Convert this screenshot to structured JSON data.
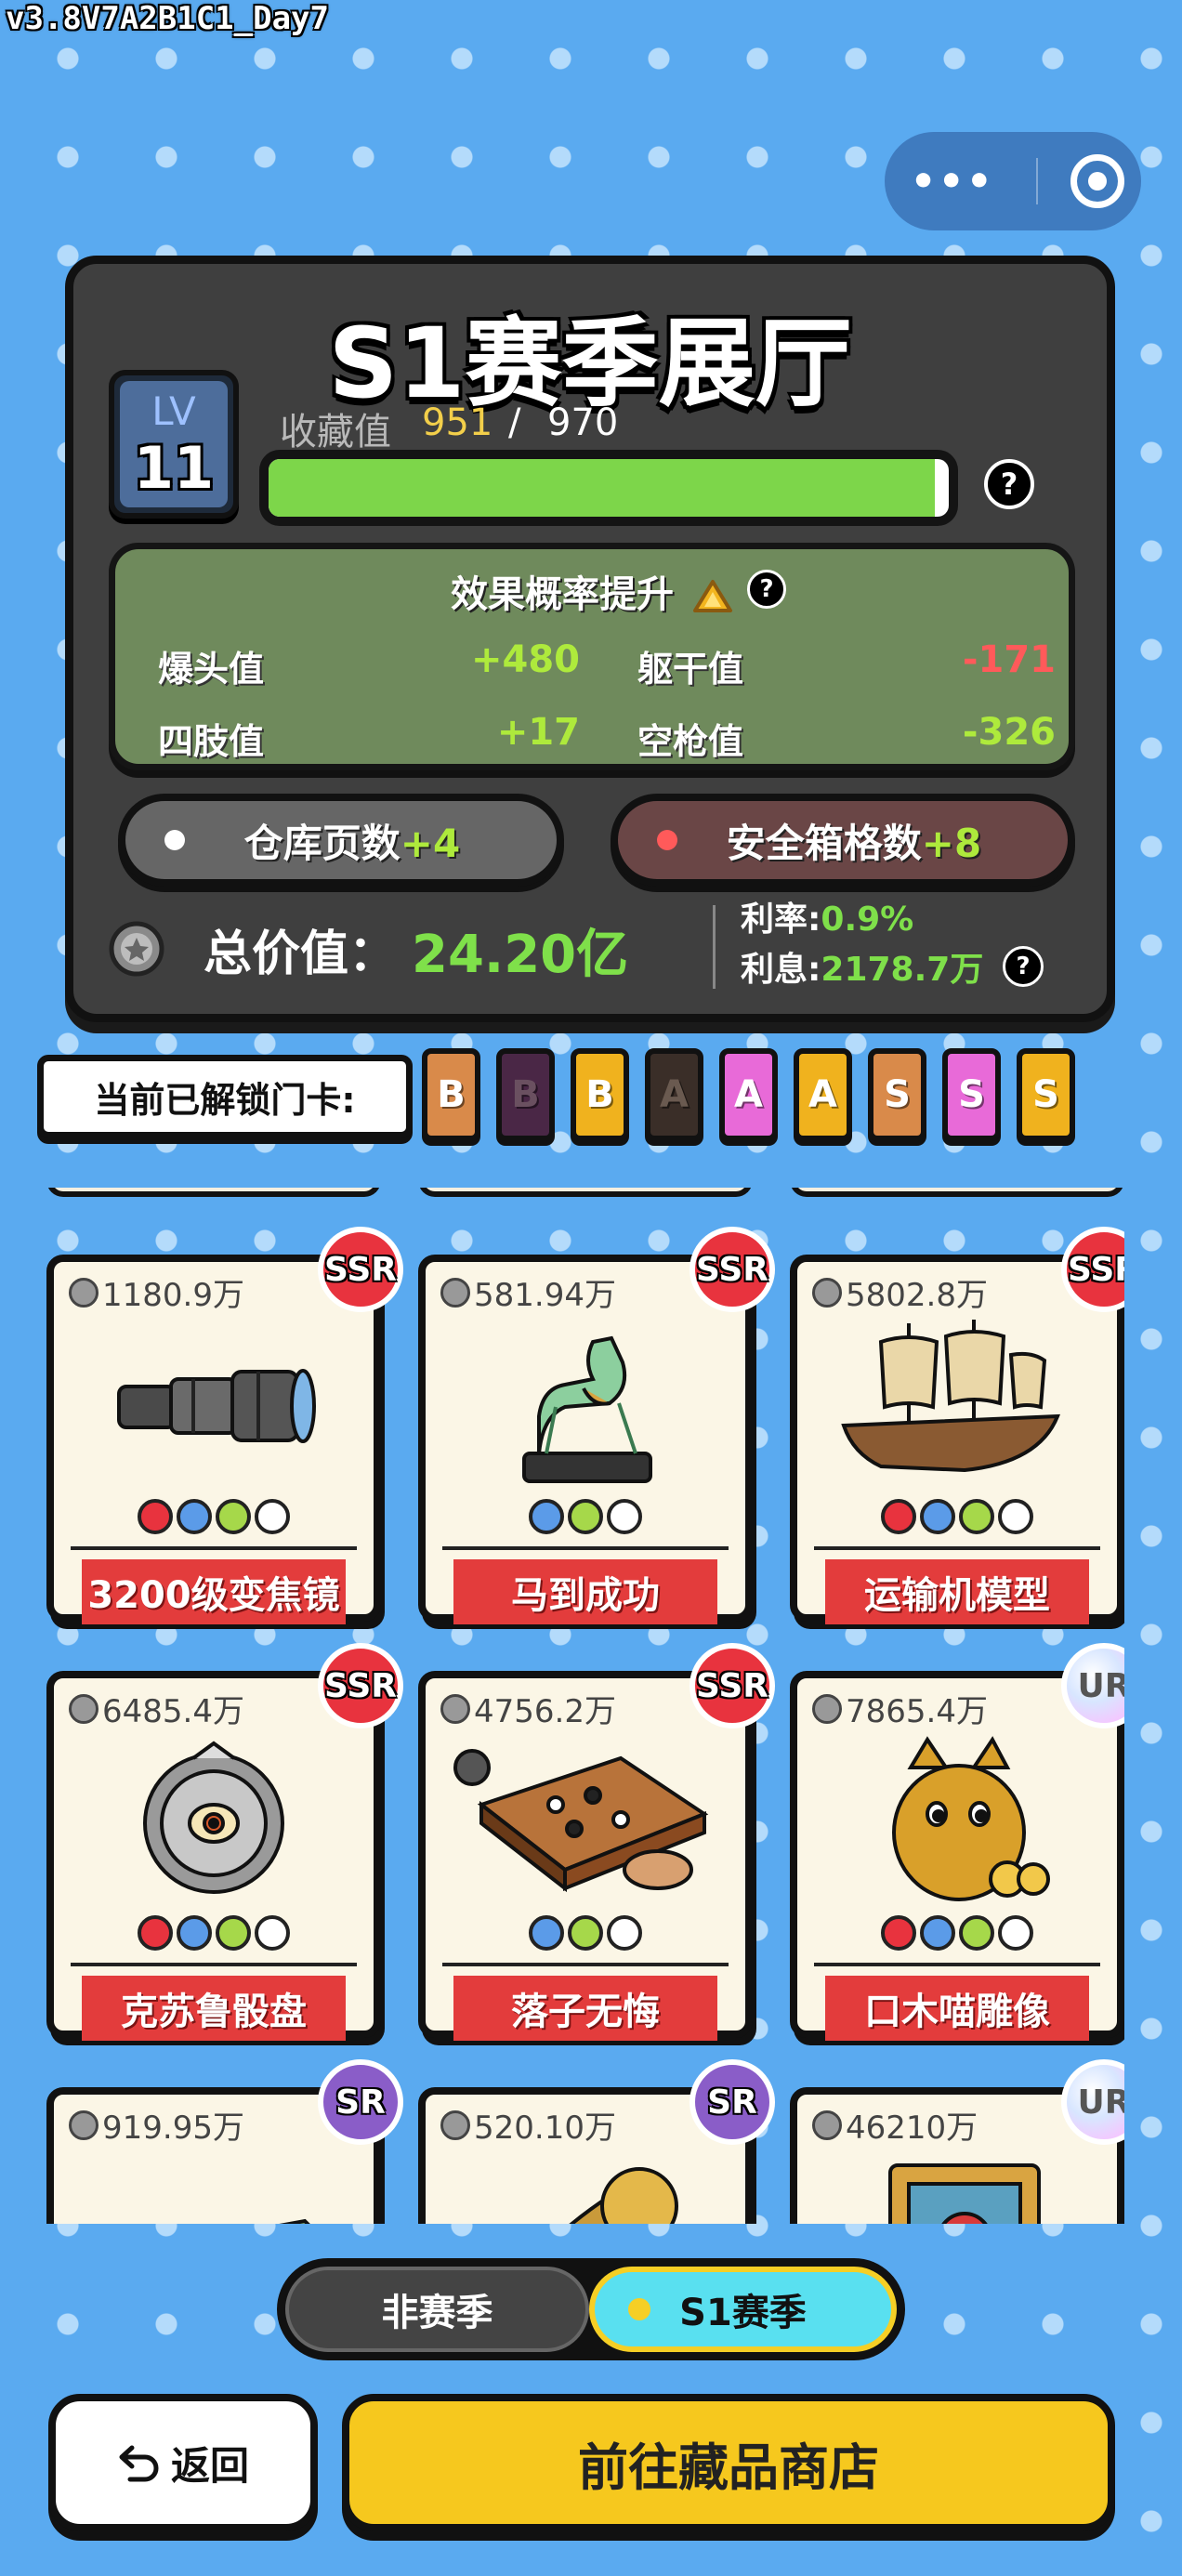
{
  "version": "v3.8V7A2B1C1_Day7",
  "capsule": {
    "more_icon": "more-dots-icon",
    "close_icon": "target-circle-icon"
  },
  "hall": {
    "title": "S1赛季展厅",
    "level_label": "LV",
    "level": "11",
    "collection_label": "收藏值",
    "collection_current": "951",
    "collection_separator": "/",
    "collection_max": "970",
    "progress_fraction": 0.98,
    "help": "?"
  },
  "effect": {
    "title": "效果概率提升",
    "help": "?",
    "stats": [
      {
        "label": "爆头值",
        "value": "+480",
        "positive": true
      },
      {
        "label": "躯干值",
        "value": "-171",
        "positive": false
      },
      {
        "label": "四肢值",
        "value": "+17",
        "positive": true
      },
      {
        "label": "空枪值",
        "value": "-326",
        "positive": false
      }
    ]
  },
  "buffs": {
    "warehouse": {
      "label": "仓库页数",
      "bonus": "+4"
    },
    "safebox": {
      "label": "安全箱格数",
      "bonus": "+8"
    }
  },
  "totals": {
    "total_label": "总价值：",
    "total_value": "24.20亿",
    "rate_label": "利率:",
    "rate_value": "0.9%",
    "interest_label": "利息:",
    "interest_value": "2178.7万",
    "help": "?"
  },
  "unlocked": {
    "label": "当前已解锁门卡:",
    "cards": [
      {
        "letter": "B",
        "color": "#d98a4a",
        "text_color": "#ffffff"
      },
      {
        "letter": "B",
        "color": "#4a2746",
        "text_color": "#6a5060"
      },
      {
        "letter": "B",
        "color": "#f0b21e",
        "text_color": "#ffffff"
      },
      {
        "letter": "A",
        "color": "#3a2e28",
        "text_color": "#6a5a50"
      },
      {
        "letter": "A",
        "color": "#e86ad8",
        "text_color": "#ffffff"
      },
      {
        "letter": "A",
        "color": "#f0b21e",
        "text_color": "#ffffff"
      },
      {
        "letter": "S",
        "color": "#d98a4a",
        "text_color": "#ffffff"
      },
      {
        "letter": "S",
        "color": "#e86ad8",
        "text_color": "#ffffff"
      },
      {
        "letter": "S",
        "color": "#f0b21e",
        "text_color": "#ffffff"
      }
    ]
  },
  "items": [
    {
      "price": "1180.9万",
      "name": "3200级变焦镜",
      "rarity": "SSR",
      "art": "telescope",
      "icons": [
        "#e8333e",
        "#5b9be8",
        "#a6d84a",
        "#ffffff"
      ]
    },
    {
      "price": "581.94万",
      "name": "马到成功",
      "rarity": "SSR",
      "art": "jade-horse",
      "icons": [
        "#5b9be8",
        "#a6d84a",
        "#ffffff"
      ]
    },
    {
      "price": "5802.8万",
      "name": "运输机模型",
      "rarity": "SSR",
      "art": "ship-model",
      "icons": [
        "#e8333e",
        "#5b9be8",
        "#a6d84a",
        "#ffffff"
      ]
    },
    {
      "price": "6485.4万",
      "name": "克苏鲁骰盘",
      "rarity": "SSR",
      "art": "eye-dial",
      "icons": [
        "#e8333e",
        "#5b9be8",
        "#a6d84a",
        "#ffffff"
      ]
    },
    {
      "price": "4756.2万",
      "name": "落子无悔",
      "rarity": "SSR",
      "art": "go-board",
      "icons": [
        "#5b9be8",
        "#a6d84a",
        "#ffffff"
      ]
    },
    {
      "price": "7865.4万",
      "name": "口木喵雕像",
      "rarity": "UR",
      "art": "cat-statue",
      "icons": [
        "#e8333e",
        "#5b9be8",
        "#a6d84a",
        "#ffffff"
      ]
    },
    {
      "price": "919.95万",
      "name": "",
      "rarity": "SR",
      "art": "crate",
      "icons": []
    },
    {
      "price": "520.10万",
      "name": "",
      "rarity": "SR",
      "art": "gramophone",
      "icons": []
    },
    {
      "price": "46210万",
      "name": "",
      "rarity": "UR",
      "art": "portrait",
      "icons": []
    }
  ],
  "season_toggle": {
    "off_season": "非赛季",
    "s1_season": "S1赛季",
    "selected": "S1赛季"
  },
  "buttons": {
    "back": "返回",
    "back_icon": "return-arrow-icon",
    "shop": "前往藏品商店"
  }
}
